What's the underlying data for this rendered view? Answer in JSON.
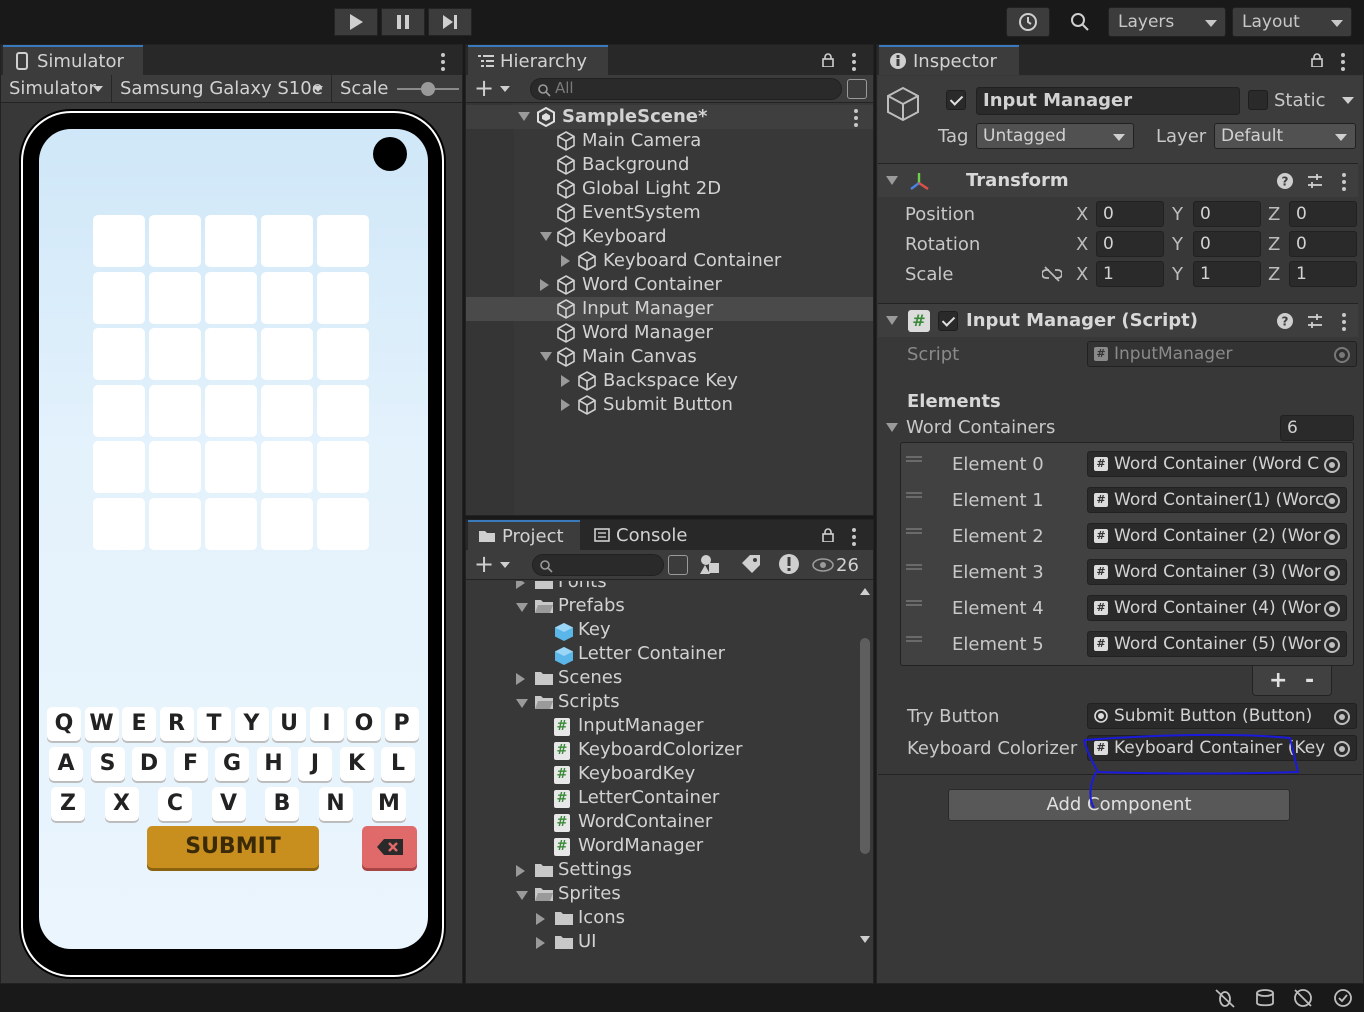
{
  "toolbar": {
    "layers_label": "Layers",
    "layout_label": "Layout"
  },
  "simulator": {
    "tab_label": "Simulator",
    "mode_label": "Simulator",
    "device_label": "Samsung Galaxy S10e",
    "scale_label": "Scale"
  },
  "game": {
    "grid_rows": 6,
    "grid_cols": 5,
    "keyboard_rows": [
      [
        "Q",
        "W",
        "E",
        "R",
        "T",
        "Y",
        "U",
        "I",
        "O",
        "P"
      ],
      [
        "A",
        "S",
        "D",
        "F",
        "G",
        "H",
        "J",
        "K",
        "L"
      ],
      [
        "Z",
        "X",
        "C",
        "V",
        "B",
        "N",
        "M"
      ]
    ],
    "submit_label": "SUBMIT",
    "colors": {
      "submit": "#c98f1e",
      "backspace": "#e06a6a",
      "sky": "#d8eefb"
    }
  },
  "hierarchy": {
    "tab_label": "Hierarchy",
    "search_placeholder": "All",
    "scene_name": "SampleScene*",
    "items": [
      {
        "label": "Main Camera"
      },
      {
        "label": "Background"
      },
      {
        "label": "Global Light 2D"
      },
      {
        "label": "EventSystem"
      },
      {
        "label": "Keyboard"
      },
      {
        "label": "Keyboard Container"
      },
      {
        "label": "Word Container"
      },
      {
        "label": "Input Manager"
      },
      {
        "label": "Word Manager"
      },
      {
        "label": "Main Canvas"
      },
      {
        "label": "Backspace Key"
      },
      {
        "label": "Submit Button"
      }
    ]
  },
  "project": {
    "tab_label": "Project",
    "console_label": "Console",
    "hidden_count": "26",
    "items": [
      {
        "label": "Fonts"
      },
      {
        "label": "Prefabs"
      },
      {
        "label": "Key"
      },
      {
        "label": "Letter Container"
      },
      {
        "label": "Scenes"
      },
      {
        "label": "Scripts"
      },
      {
        "label": "InputManager"
      },
      {
        "label": "KeyboardColorizer"
      },
      {
        "label": "KeyboardKey"
      },
      {
        "label": "LetterContainer"
      },
      {
        "label": "WordContainer"
      },
      {
        "label": "WordManager"
      },
      {
        "label": "Settings"
      },
      {
        "label": "Sprites"
      },
      {
        "label": "Icons"
      },
      {
        "label": "UI"
      }
    ]
  },
  "inspector": {
    "tab_label": "Inspector",
    "object_name": "Input Manager",
    "static_label": "Static",
    "tag_label": "Tag",
    "tag_value": "Untagged",
    "layer_label": "Layer",
    "layer_value": "Default",
    "transform": {
      "title": "Transform",
      "rows": [
        {
          "label": "Position",
          "x": "0",
          "y": "0",
          "z": "0"
        },
        {
          "label": "Rotation",
          "x": "0",
          "y": "0",
          "z": "0"
        },
        {
          "label": "Scale",
          "x": "1",
          "y": "1",
          "z": "1"
        }
      ],
      "axis_x": "X",
      "axis_y": "Y",
      "axis_z": "Z"
    },
    "script_component": {
      "title": "Input Manager (Script)",
      "script_label": "Script",
      "script_value": "InputManager",
      "elements_heading": "Elements",
      "word_containers_label": "Word Containers",
      "word_containers_count": "6",
      "elements": [
        {
          "label": "Element 0",
          "value": "Word Container (Word C"
        },
        {
          "label": "Element 1",
          "value": "Word Container(1) (Worc"
        },
        {
          "label": "Element 2",
          "value": "Word Container (2) (Wor"
        },
        {
          "label": "Element 3",
          "value": "Word Container (3) (Wor"
        },
        {
          "label": "Element 4",
          "value": "Word Container (4) (Wor"
        },
        {
          "label": "Element 5",
          "value": "Word Container (5) (Wor"
        }
      ],
      "add_label": "+",
      "remove_label": "-",
      "try_button_label": "Try Button",
      "try_button_value": "Submit Button (Button)",
      "keyboard_colorizer_label": "Keyboard Colorizer",
      "keyboard_colorizer_value": "Keyboard Container (Key"
    },
    "add_component_label": "Add Component"
  }
}
